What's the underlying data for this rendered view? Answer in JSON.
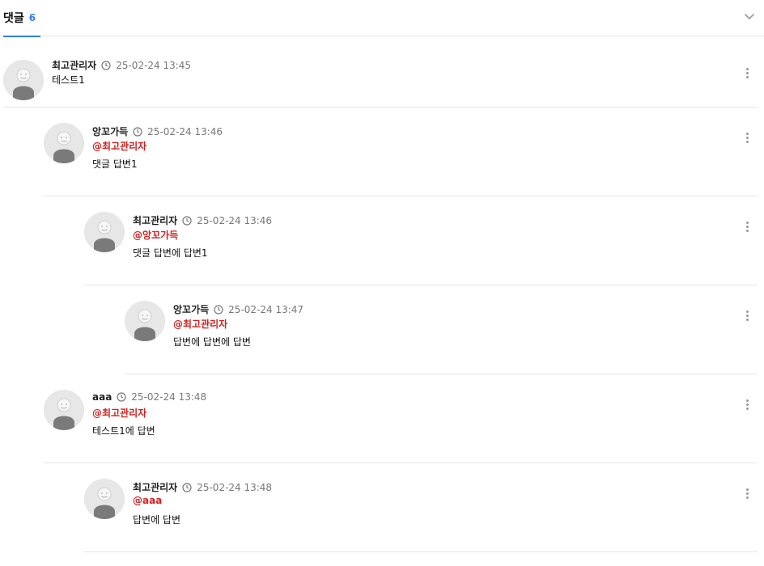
{
  "header": {
    "title": "댓글",
    "count": "6"
  },
  "comments": [
    {
      "author": "최고관리자",
      "time": "25-02-24 13:45",
      "mention": "",
      "text": "테스트1"
    },
    {
      "author": "앙꼬가득",
      "time": "25-02-24 13:46",
      "mention": "@최고관리자",
      "text": "댓글 답변1"
    },
    {
      "author": "최고관리자",
      "time": "25-02-24 13:46",
      "mention": "@앙꼬가득",
      "text": "댓글 답변에 답변1"
    },
    {
      "author": "앙꼬가득",
      "time": "25-02-24 13:47",
      "mention": "@최고관리자",
      "text": "답변에 답변에 답변"
    },
    {
      "author": "aaa",
      "time": "25-02-24 13:48",
      "mention": "@최고관리자",
      "text": "테스트1에 답변"
    },
    {
      "author": "최고관리자",
      "time": "25-02-24 13:48",
      "mention": "@aaa",
      "text": "답변에 답변"
    }
  ],
  "icons": {
    "collapse": "chevron-down-icon",
    "avatar": "avatar-icon",
    "clock": "clock-icon",
    "more": "more-vertical-icon"
  },
  "colors": {
    "accent": "#2f80ed",
    "mention": "#d11f1f"
  }
}
